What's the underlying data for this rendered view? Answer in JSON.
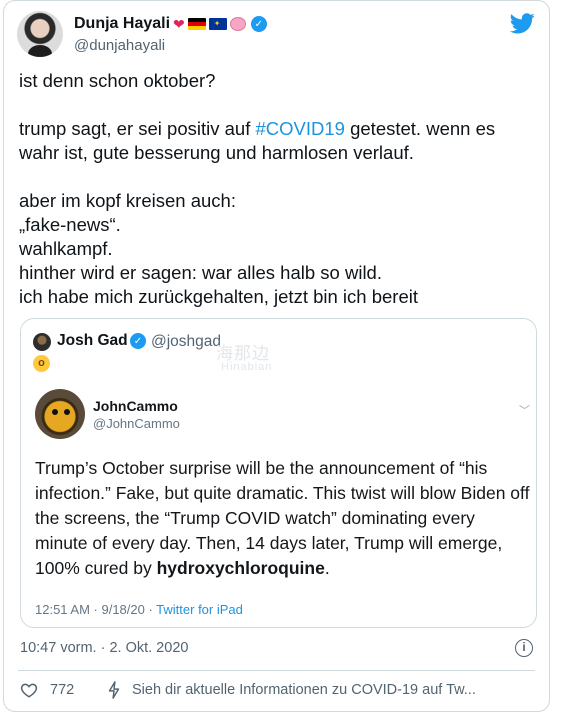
{
  "author": {
    "display_name": "Dunja Hayali",
    "handle": "@dunjahayali",
    "name_emojis": [
      "heart-icon",
      "german-flag-icon",
      "eu-flag-icon",
      "brain-icon"
    ]
  },
  "tweet": {
    "line1": "ist denn schon oktober?",
    "line2_before": "trump sagt, er sei positiv auf ",
    "hashtag": "#COVID19",
    "line2_after": " getestet. wenn es wahr ist, gute besserung und harmlosen verlauf.",
    "line3": "aber im kopf kreisen auch:\n„fake-news“.\nwahlkampf.\nhinther wird er sagen: war alles halb so wild.\nich habe mich zurückgehalten, jetzt bin ich bereit"
  },
  "quote": {
    "display_name": "Josh Gad",
    "handle": "@joshgad",
    "emoji_icon": "astonished-face-icon",
    "watermark": "海那边",
    "watermark_sub": "Hinabian"
  },
  "embedded": {
    "display_name": "JohnCammo",
    "handle": "@JohnCammo",
    "text_before": "Trump’s October surprise will be the announcement of “his infection.”  Fake, but quite dramatic. This twist will blow Biden off the screens, the “Trump COVID watch” dominating every minute of every day.  Then, 14 days later, Trump will emerge, 100% cured by ",
    "text_bold": "hydroxychloroquine",
    "text_after": ".",
    "time_date": "12:51 AM · 9/18/20 · ",
    "source": "Twitter for iPad"
  },
  "timestamp": "10:47 vorm. · 2. Okt. 2020",
  "likes": "772",
  "covid_link": "Sieh dir aktuelle Informationen zu COVID-19 auf Tw...",
  "colors": {
    "accent": "#1d9bf0",
    "hashtag": "#1b95e0",
    "secondary_text": "#536471"
  }
}
